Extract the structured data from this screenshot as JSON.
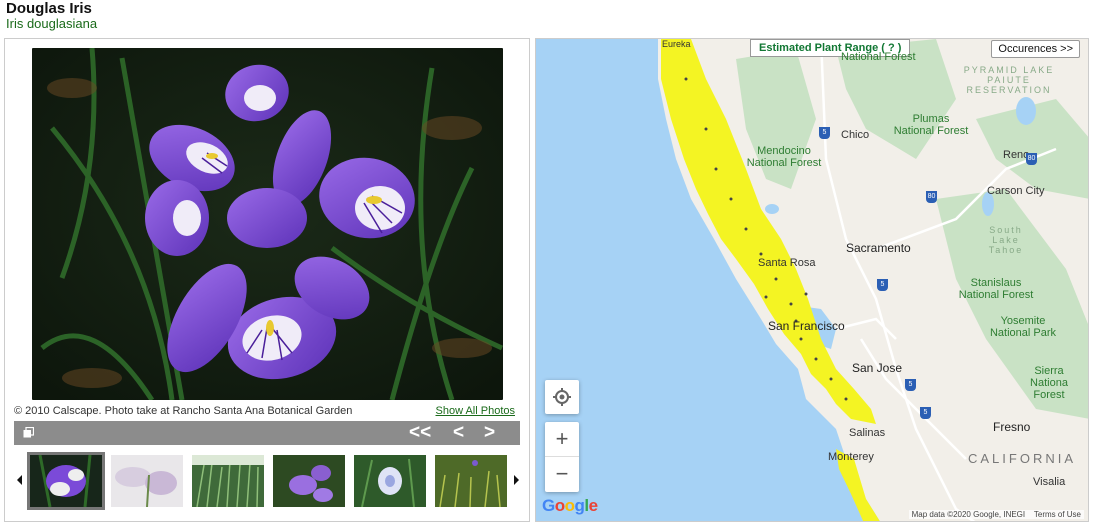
{
  "plant": {
    "common_name": "Douglas Iris",
    "scientific_name": "Iris douglasiana"
  },
  "photo": {
    "caption": "© 2010 Calscape. Photo take at Rancho Santa Ana Botanical Garden",
    "show_all_label": "Show All Photos"
  },
  "nav": {
    "first_label": "<<",
    "prev_label": "<",
    "next_label": ">"
  },
  "map": {
    "range_label": "Estimated Plant Range ( ? )",
    "occurrences_label": "Occurences >>",
    "zoom_in_label": "+",
    "zoom_out_label": "−",
    "attribution_data": "Map data ©2020 Google, INEGI",
    "attribution_terms": "Terms of Use",
    "google_logo": "Google",
    "labels": {
      "national_forest_top": "National Forest",
      "pyramid_lake": "PYRAMID LAKE PAIUTE RESERVATION",
      "chico": "Chico",
      "plumas": "Plumas National Forest",
      "mendocino": "Mendocino National Forest",
      "reno": "Reno",
      "carson": "Carson City",
      "sacramento": "Sacramento",
      "south_lake": "South Lake Tahoe",
      "santa_rosa": "Santa Rosa",
      "stanislaus": "Stanislaus National Forest",
      "san_francisco": "San Francisco",
      "yosemite": "Yosemite National Park",
      "san_jose": "San Jose",
      "sierra": "Sierra Nationa Forest",
      "fresno": "Fresno",
      "salinas": "Salinas",
      "monterey": "Monterey",
      "california": "CALIFORNIA",
      "visalia": "Visalia",
      "eureka": "Eureka"
    },
    "shields": [
      "5",
      "80",
      "80",
      "5",
      "5",
      "5"
    ]
  },
  "colors": {
    "range": "#f4f423",
    "water": "#a6d2f5",
    "forest": "#c9e2c5",
    "nav_bar": "#8c8c8c"
  }
}
